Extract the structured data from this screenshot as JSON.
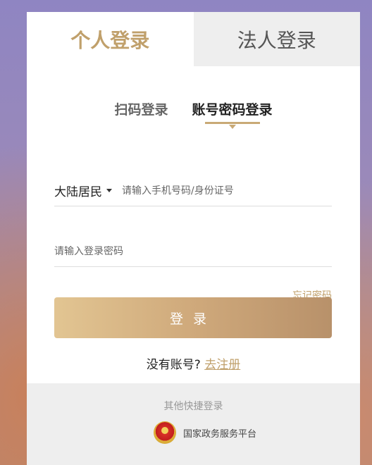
{
  "tabs": {
    "personal": "个人登录",
    "legal": "法人登录"
  },
  "subtabs": {
    "scan": "扫码登录",
    "account": "账号密码登录"
  },
  "form": {
    "region": "大陆居民",
    "phone_placeholder": "请输入手机号码/身份证号",
    "password_placeholder": "请输入登录密码",
    "forgot": "忘记密码",
    "login": "登录"
  },
  "register": {
    "prompt": "没有账号?",
    "link": "去注册"
  },
  "footer": {
    "title": "其他快捷登录",
    "platform": "国家政务服务平台"
  },
  "colors": {
    "accent": "#c0a06b",
    "button_start": "#e2c592",
    "button_end": "#b8916a"
  }
}
